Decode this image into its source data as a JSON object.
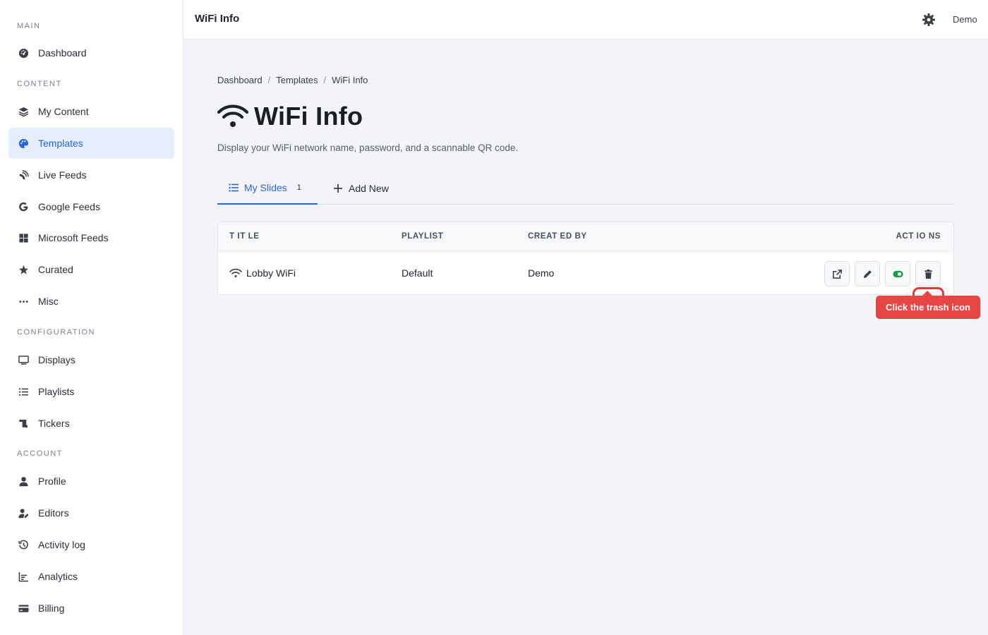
{
  "sidebar": {
    "sections": [
      "MAIN",
      "CONTENT",
      "CONFIGURATION",
      "ACCOUNT"
    ],
    "items": [
      {
        "label": "Dashboard",
        "icon": "dashboard-icon"
      },
      {
        "label": "My Content",
        "icon": "layers-icon"
      },
      {
        "label": "Templates",
        "icon": "palette-icon",
        "active": true
      },
      {
        "label": "Live Feeds",
        "icon": "satellite-dish-icon"
      },
      {
        "label": "Google Feeds",
        "icon": "google-icon"
      },
      {
        "label": "Microsoft Feeds",
        "icon": "windows-icon"
      },
      {
        "label": "Curated",
        "icon": "star-icon"
      },
      {
        "label": "Misc",
        "icon": "ellipsis-icon"
      },
      {
        "label": "Displays",
        "icon": "monitor-icon"
      },
      {
        "label": "Playlists",
        "icon": "list-icon"
      },
      {
        "label": "Tickers",
        "icon": "scroll-icon"
      },
      {
        "label": "Profile",
        "icon": "user-icon"
      },
      {
        "label": "Editors",
        "icon": "user-edit-icon"
      },
      {
        "label": "Activity log",
        "icon": "history-icon"
      },
      {
        "label": "Analytics",
        "icon": "chart-icon"
      },
      {
        "label": "Billing",
        "icon": "credit-card-icon"
      }
    ]
  },
  "header": {
    "title": "WiFi Info",
    "user": "Demo"
  },
  "breadcrumb": [
    "Dashboard",
    "Templates",
    "WiFi Info"
  ],
  "page": {
    "title": "WiFi Info",
    "subtitle": "Display your WiFi network name, password, and a scannable QR code."
  },
  "tabs": {
    "my_slides": "My Slides",
    "my_slides_count": "1",
    "add_new": "Add New"
  },
  "table": {
    "headers": [
      "T IT LE",
      "PLAYLIST",
      "CREAT ED BY",
      "ACT IO NS"
    ],
    "rows": [
      {
        "title": "Lobby WiFi",
        "playlist": "Default",
        "created_by": "Demo"
      }
    ]
  },
  "tooltip": "Click the trash icon",
  "colors": {
    "accent": "#2a66d6",
    "active_bg": "#e4eefc",
    "toggle_on": "#1a9e4b",
    "highlight": "#e53935"
  }
}
